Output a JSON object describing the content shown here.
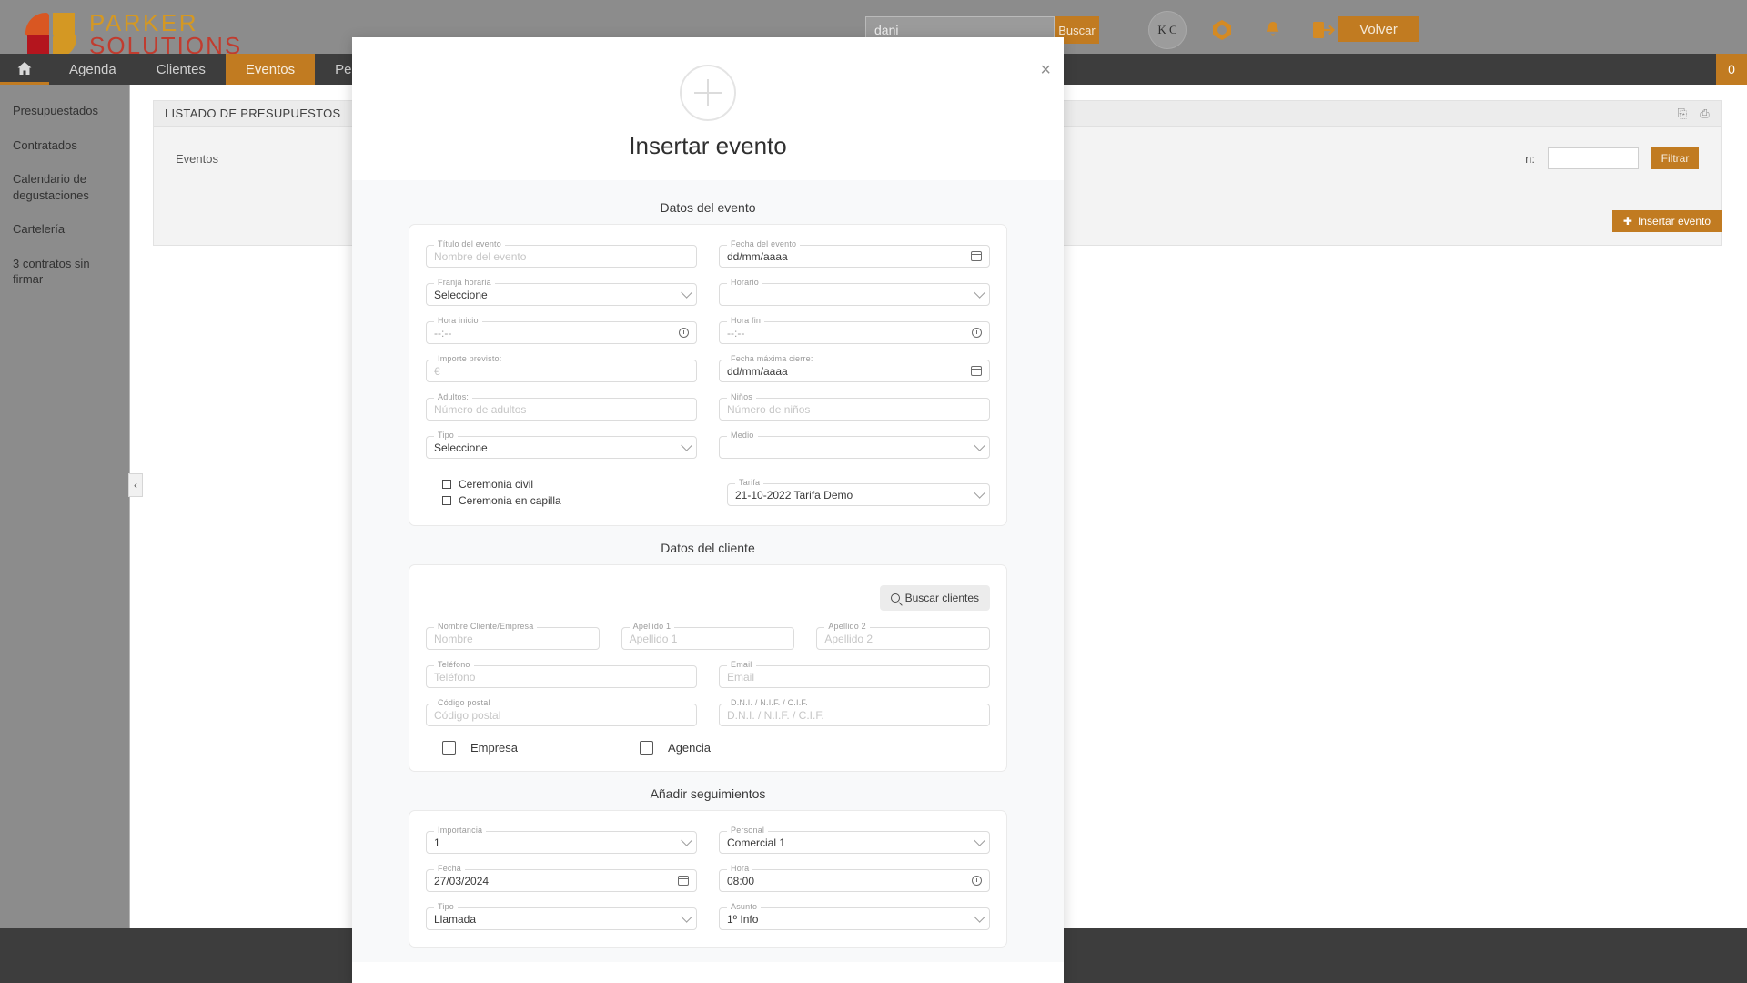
{
  "header": {
    "logo_line1": "PARKER",
    "logo_line2": "SOLUTIONS",
    "search_value": "dani",
    "search_button": "Buscar",
    "avatar_initials": "K C",
    "back_button": "Volver",
    "icons": [
      "nut-icon",
      "bell-icon",
      "logout-icon"
    ]
  },
  "nav": {
    "home_icon": "home-icon",
    "items": [
      {
        "label": "Agenda",
        "active": false
      },
      {
        "label": "Clientes",
        "active": false
      },
      {
        "label": "Eventos",
        "active": true
      },
      {
        "label": "Pedidos APP",
        "active": false
      }
    ],
    "badge": "0"
  },
  "sidebar": {
    "items": [
      {
        "label": "Presupuestados"
      },
      {
        "label": "Contratados"
      },
      {
        "label": "Calendario de degustaciones"
      },
      {
        "label": "Cartelería"
      },
      {
        "label": "3 contratos sin firmar"
      }
    ],
    "collapse_icon": "chevron-left-icon"
  },
  "page": {
    "panel_title": "LISTADO DE PRESUPUESTOS",
    "filter_label_left": "Eventos",
    "filter_label_right": "n:",
    "filter_value": "",
    "filter_button": "Filtrar",
    "insert_button": "Insertar evento"
  },
  "modal": {
    "title": "Insertar evento",
    "plus_icon": "plus-circle-icon",
    "close_icon": "close-icon",
    "sections": {
      "event": {
        "title": "Datos del evento",
        "fields": {
          "titulo": {
            "label": "Título del evento",
            "placeholder": "Nombre del evento",
            "value": ""
          },
          "fecha": {
            "label": "Fecha del evento",
            "value": "dd/mm/aaaa"
          },
          "franja": {
            "label": "Franja horaria",
            "value": "Seleccione"
          },
          "horario": {
            "label": "Horario",
            "value": ""
          },
          "hora_inicio": {
            "label": "Hora inicio",
            "value": "--:--"
          },
          "hora_fin": {
            "label": "Hora fin",
            "value": "--:--"
          },
          "importe": {
            "label": "Importe previsto:",
            "placeholder": "€",
            "value": ""
          },
          "fecha_max": {
            "label": "Fecha máxima cierre:",
            "value": "dd/mm/aaaa"
          },
          "adultos": {
            "label": "Adultos:",
            "placeholder": "Número de adultos",
            "value": ""
          },
          "ninos": {
            "label": "Niños",
            "placeholder": "Número de niños",
            "value": ""
          },
          "tipo": {
            "label": "Tipo",
            "value": "Seleccione"
          },
          "medio": {
            "label": "Medio",
            "value": ""
          },
          "tarifa": {
            "label": "Tarifa",
            "value": "21-10-2022 Tarifa Demo"
          }
        },
        "checkboxes": [
          {
            "label": "Ceremonia civil",
            "checked": false
          },
          {
            "label": "Ceremonia en capilla",
            "checked": false
          }
        ]
      },
      "client": {
        "title": "Datos del cliente",
        "search_button": "Buscar clientes",
        "search_icon": "search-icon",
        "fields": {
          "nombre": {
            "label": "Nombre Cliente/Empresa",
            "placeholder": "Nombre",
            "value": ""
          },
          "apellido1": {
            "label": "Apellido 1",
            "placeholder": "Apellido 1",
            "value": ""
          },
          "apellido2": {
            "label": "Apellido 2",
            "placeholder": "Apellido 2",
            "value": ""
          },
          "telefono": {
            "label": "Teléfono",
            "placeholder": "Teléfono",
            "value": ""
          },
          "email": {
            "label": "Email",
            "placeholder": "Email",
            "value": ""
          },
          "cp": {
            "label": "Código postal",
            "placeholder": "Código postal",
            "value": ""
          },
          "dni": {
            "label": "D.N.I. / N.I.F. / C.I.F.",
            "placeholder": "D.N.I. / N.I.F. / C.I.F.",
            "value": ""
          }
        },
        "checkboxes": [
          {
            "label": "Empresa",
            "checked": false
          },
          {
            "label": "Agencia",
            "checked": false
          }
        ]
      },
      "followups": {
        "title": "Añadir seguimientos",
        "fields": {
          "importancia": {
            "label": "Importancia",
            "value": "1"
          },
          "personal": {
            "label": "Personal",
            "value": "Comercial 1"
          },
          "fecha": {
            "label": "Fecha",
            "value": "27/03/2024"
          },
          "hora": {
            "label": "Hora",
            "value": "08:00"
          },
          "tipo": {
            "label": "Tipo",
            "value": "Llamada"
          },
          "asunto": {
            "label": "Asunto",
            "value": "1º Info"
          }
        }
      }
    }
  },
  "colors": {
    "accent": "#c0791d",
    "nav_dark": "#3a3a3a",
    "topbar": "#8a8a8a",
    "logo_orange": "#d4961f",
    "logo_red": "#c0392b"
  }
}
